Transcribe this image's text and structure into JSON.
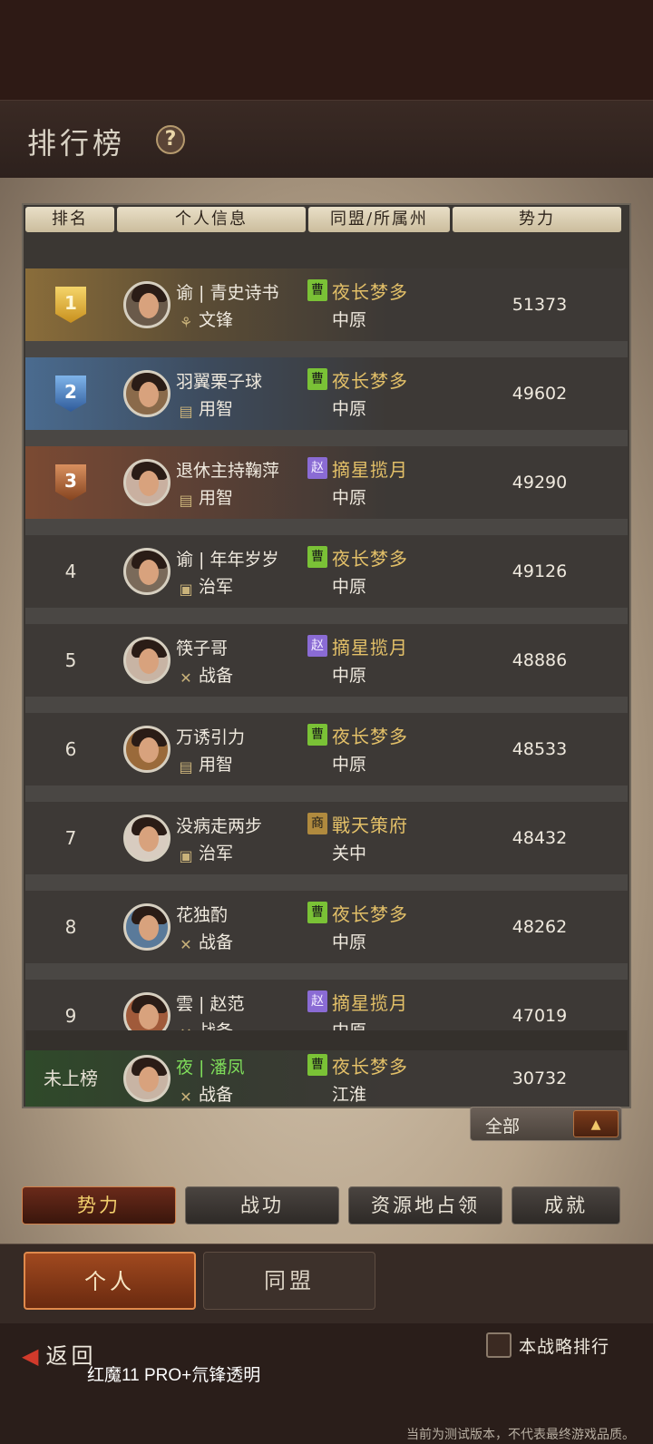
{
  "title": "排行榜",
  "help_icon": "?",
  "table": {
    "headers": [
      "排名",
      "个人信息",
      "同盟/所属州",
      "势力"
    ],
    "rows": [
      {
        "rank": "1",
        "name": "谕 | 青史诗书",
        "role_icon": "grain-icon",
        "role": "文锋",
        "flag": "曹",
        "flag_color": "#7ac236",
        "alliance": "夜长梦多",
        "state": "中原",
        "power": "51373"
      },
      {
        "rank": "2",
        "name": "羽翼栗子球",
        "role_icon": "scroll-icon",
        "role": "用智",
        "flag": "曹",
        "flag_color": "#7ac236",
        "alliance": "夜长梦多",
        "state": "中原",
        "power": "49602"
      },
      {
        "rank": "3",
        "name": "退休主持鞠萍",
        "role_icon": "scroll-icon",
        "role": "用智",
        "flag": "赵",
        "flag_color": "#8a6bd4",
        "alliance": "摘星揽月",
        "state": "中原",
        "power": "49290"
      },
      {
        "rank": "4",
        "name": "谕 | 年年岁岁",
        "role_icon": "shield-icon",
        "role": "治军",
        "flag": "曹",
        "flag_color": "#7ac236",
        "alliance": "夜长梦多",
        "state": "中原",
        "power": "49126"
      },
      {
        "rank": "5",
        "name": "筷子哥",
        "role_icon": "crossed-swords-icon",
        "role": "战备",
        "flag": "赵",
        "flag_color": "#8a6bd4",
        "alliance": "摘星揽月",
        "state": "中原",
        "power": "48886"
      },
      {
        "rank": "6",
        "name": "万诱引力",
        "role_icon": "scroll-icon",
        "role": "用智",
        "flag": "曹",
        "flag_color": "#7ac236",
        "alliance": "夜长梦多",
        "state": "中原",
        "power": "48533"
      },
      {
        "rank": "7",
        "name": "没病走两步",
        "role_icon": "shield-icon",
        "role": "治军",
        "flag": "商",
        "flag_color": "#b08a3e",
        "alliance": "戰天策府",
        "state": "关中",
        "power": "48432"
      },
      {
        "rank": "8",
        "name": "花独酌",
        "role_icon": "crossed-swords-icon",
        "role": "战备",
        "flag": "曹",
        "flag_color": "#7ac236",
        "alliance": "夜长梦多",
        "state": "中原",
        "power": "48262"
      },
      {
        "rank": "9",
        "name": "雲 | 赵范",
        "role_icon": "crossed-swords-icon",
        "role": "战备",
        "flag": "赵",
        "flag_color": "#8a6bd4",
        "alliance": "摘星揽月",
        "state": "中原",
        "power": "47019"
      }
    ],
    "my_row": {
      "rank": "未上榜",
      "name": "夜 | 潘凤",
      "role_icon": "crossed-swords-icon",
      "role": "战备",
      "flag": "曹",
      "flag_color": "#7ac236",
      "alliance": "夜长梦多",
      "state": "江淮",
      "power": "30732"
    }
  },
  "filter": {
    "label": "全部",
    "arrow": "▲"
  },
  "category_tabs": [
    "势力",
    "战功",
    "资源地占领",
    "成就"
  ],
  "scope_tabs": {
    "active": "个人",
    "inactive": "同盟"
  },
  "back_label": "返回",
  "device_label": "红魔11 PRO+氘锋透明",
  "checkbox_label": "本战略排行",
  "footer_note": "当前为测试版本，不代表最终游戏品质。"
}
